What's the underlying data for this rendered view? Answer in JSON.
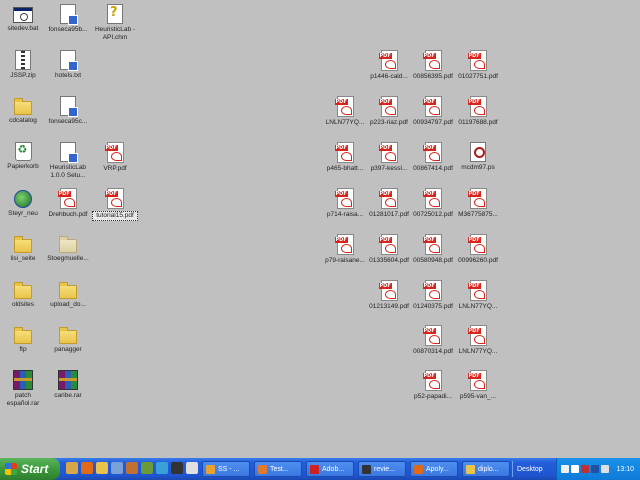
{
  "desktop": {
    "icons": [
      {
        "label": "sitedev.bat",
        "type": "bat",
        "icon": "batch-file-icon"
      },
      {
        "label": "fonseca95b...",
        "type": "doc",
        "icon": "document-icon"
      },
      {
        "label": "HeuristicLab - API.chm",
        "type": "chm",
        "icon": "help-file-icon"
      },
      {
        "label": "JSSP.zip",
        "type": "zip",
        "icon": "zip-file-icon"
      },
      {
        "label": "hotels.txt",
        "type": "doc",
        "icon": "text-file-icon"
      },
      {
        "label": "cdcatalog",
        "type": "folder",
        "icon": "folder-icon"
      },
      {
        "label": "fonseca95c...",
        "type": "doc",
        "icon": "document-icon"
      },
      {
        "label": "Papierkorb",
        "type": "recycle",
        "icon": "recycle-bin-icon"
      },
      {
        "label": "HeuristicLab 1.0.0 Setu...",
        "type": "doc",
        "icon": "installer-icon"
      },
      {
        "label": "VRP.pdf",
        "type": "pdf",
        "icon": "pdf-file-icon"
      },
      {
        "label": "Steyr_neu",
        "type": "globe",
        "icon": "shortcut-icon"
      },
      {
        "label": "Drehbuch.pdf",
        "type": "pdf",
        "icon": "pdf-file-icon"
      },
      {
        "label": "tutorial15.pdf",
        "type": "pdf",
        "icon": "pdf-file-icon",
        "selected": true
      },
      {
        "label": "lisi_seite",
        "type": "folder",
        "icon": "folder-icon"
      },
      {
        "label": "Stoegmuelle...",
        "type": "folder-pale",
        "icon": "folder-icon"
      },
      {
        "label": "oldsites",
        "type": "folder",
        "icon": "folder-icon"
      },
      {
        "label": "upload_do...",
        "type": "folder",
        "icon": "folder-icon"
      },
      {
        "label": "ftp",
        "type": "folder",
        "icon": "folder-icon"
      },
      {
        "label": "panagger",
        "type": "folder",
        "icon": "folder-icon"
      },
      {
        "label": "patch español.rar",
        "type": "rar",
        "icon": "rar-archive-icon"
      },
      {
        "label": "caribe.rar",
        "type": "rar",
        "icon": "rar-archive-icon"
      },
      {
        "label": "p1446-cald...",
        "type": "pdf",
        "icon": "pdf-file-icon"
      },
      {
        "label": "00856395.pdf",
        "type": "pdf",
        "icon": "pdf-file-icon"
      },
      {
        "label": "01027751.pdf",
        "type": "pdf",
        "icon": "pdf-file-icon"
      },
      {
        "label": "LNLN77YQ...",
        "type": "pdf",
        "icon": "pdf-file-icon"
      },
      {
        "label": "p223-riaz.pdf",
        "type": "pdf",
        "icon": "pdf-file-icon"
      },
      {
        "label": "00934797.pdf",
        "type": "pdf",
        "icon": "pdf-file-icon"
      },
      {
        "label": "01197688.pdf",
        "type": "pdf",
        "icon": "pdf-file-icon"
      },
      {
        "label": "p465-bhatt...",
        "type": "pdf",
        "icon": "pdf-file-icon"
      },
      {
        "label": "p397-kessl...",
        "type": "pdf",
        "icon": "pdf-file-icon"
      },
      {
        "label": "00867414.pdf",
        "type": "pdf",
        "icon": "pdf-file-icon"
      },
      {
        "label": "mcdm97.ps",
        "type": "ps",
        "icon": "postscript-file-icon"
      },
      {
        "label": "p714-raisa...",
        "type": "pdf",
        "icon": "pdf-file-icon"
      },
      {
        "label": "01281017.pdf",
        "type": "pdf",
        "icon": "pdf-file-icon"
      },
      {
        "label": "00725012.pdf",
        "type": "pdf",
        "icon": "pdf-file-icon"
      },
      {
        "label": "M36775875...",
        "type": "pdf",
        "icon": "pdf-file-icon"
      },
      {
        "label": "p79-raisane...",
        "type": "pdf",
        "icon": "pdf-file-icon"
      },
      {
        "label": "01335604.pdf",
        "type": "pdf",
        "icon": "pdf-file-icon"
      },
      {
        "label": "00580948.pdf",
        "type": "pdf",
        "icon": "pdf-file-icon"
      },
      {
        "label": "00996260.pdf",
        "type": "pdf",
        "icon": "pdf-file-icon"
      },
      {
        "label": "01213149.pdf",
        "type": "pdf",
        "icon": "pdf-file-icon"
      },
      {
        "label": "01240375.pdf",
        "type": "pdf",
        "icon": "pdf-file-icon"
      },
      {
        "label": "LNLN77YQ...",
        "type": "pdf",
        "icon": "pdf-file-icon"
      },
      {
        "label": "00870314.pdf",
        "type": "pdf",
        "icon": "pdf-file-icon"
      },
      {
        "label": "LNLN77YQ...",
        "type": "pdf",
        "icon": "pdf-file-icon"
      },
      {
        "label": "p52-papadi...",
        "type": "pdf",
        "icon": "pdf-file-icon"
      },
      {
        "label": "p595-van_...",
        "type": "pdf",
        "icon": "pdf-file-icon"
      }
    ]
  },
  "taskbar": {
    "start_label": "Start",
    "quick_launch": [
      {
        "icon": "desktop-icon",
        "color": "#d9a54a"
      },
      {
        "icon": "firefox-icon",
        "color": "#e06a1a"
      },
      {
        "icon": "explorer-icon",
        "color": "#e8c24a"
      },
      {
        "icon": "media-icon",
        "color": "#7aa0d8"
      },
      {
        "icon": "tool-icon",
        "color": "#c07030"
      },
      {
        "icon": "app-icon",
        "color": "#6a9a3a"
      },
      {
        "icon": "globe-icon",
        "color": "#3aa0d8"
      },
      {
        "icon": "player-icon",
        "color": "#333333"
      },
      {
        "icon": "more-icon",
        "color": "#e0e0e0"
      }
    ],
    "tasks": [
      {
        "label": "SS - ...",
        "icon": "app-icon",
        "color": "#e8a030"
      },
      {
        "label": "Test...",
        "icon": "app-icon",
        "color": "#e07a30"
      },
      {
        "label": "Adob...",
        "icon": "acrobat-icon",
        "color": "#cc2222"
      },
      {
        "label": "revie...",
        "icon": "media-icon",
        "color": "#333333"
      },
      {
        "label": "Apoly...",
        "icon": "firefox-icon",
        "color": "#e06a1a"
      },
      {
        "label": "diplo...",
        "icon": "folder-icon",
        "color": "#e9c44a"
      }
    ],
    "desktop_toolbar": "Desktop",
    "tray_icons": [
      {
        "icon": "tray-app-icon",
        "color": "#f0f0f0"
      },
      {
        "icon": "tray-network-icon",
        "color": "#ffffff"
      },
      {
        "icon": "tray-security-icon",
        "color": "#c03030"
      },
      {
        "icon": "tray-display-icon",
        "color": "#2050a0"
      },
      {
        "icon": "tray-volume-icon",
        "color": "#e0e0e0"
      }
    ],
    "clock": "13:10"
  }
}
